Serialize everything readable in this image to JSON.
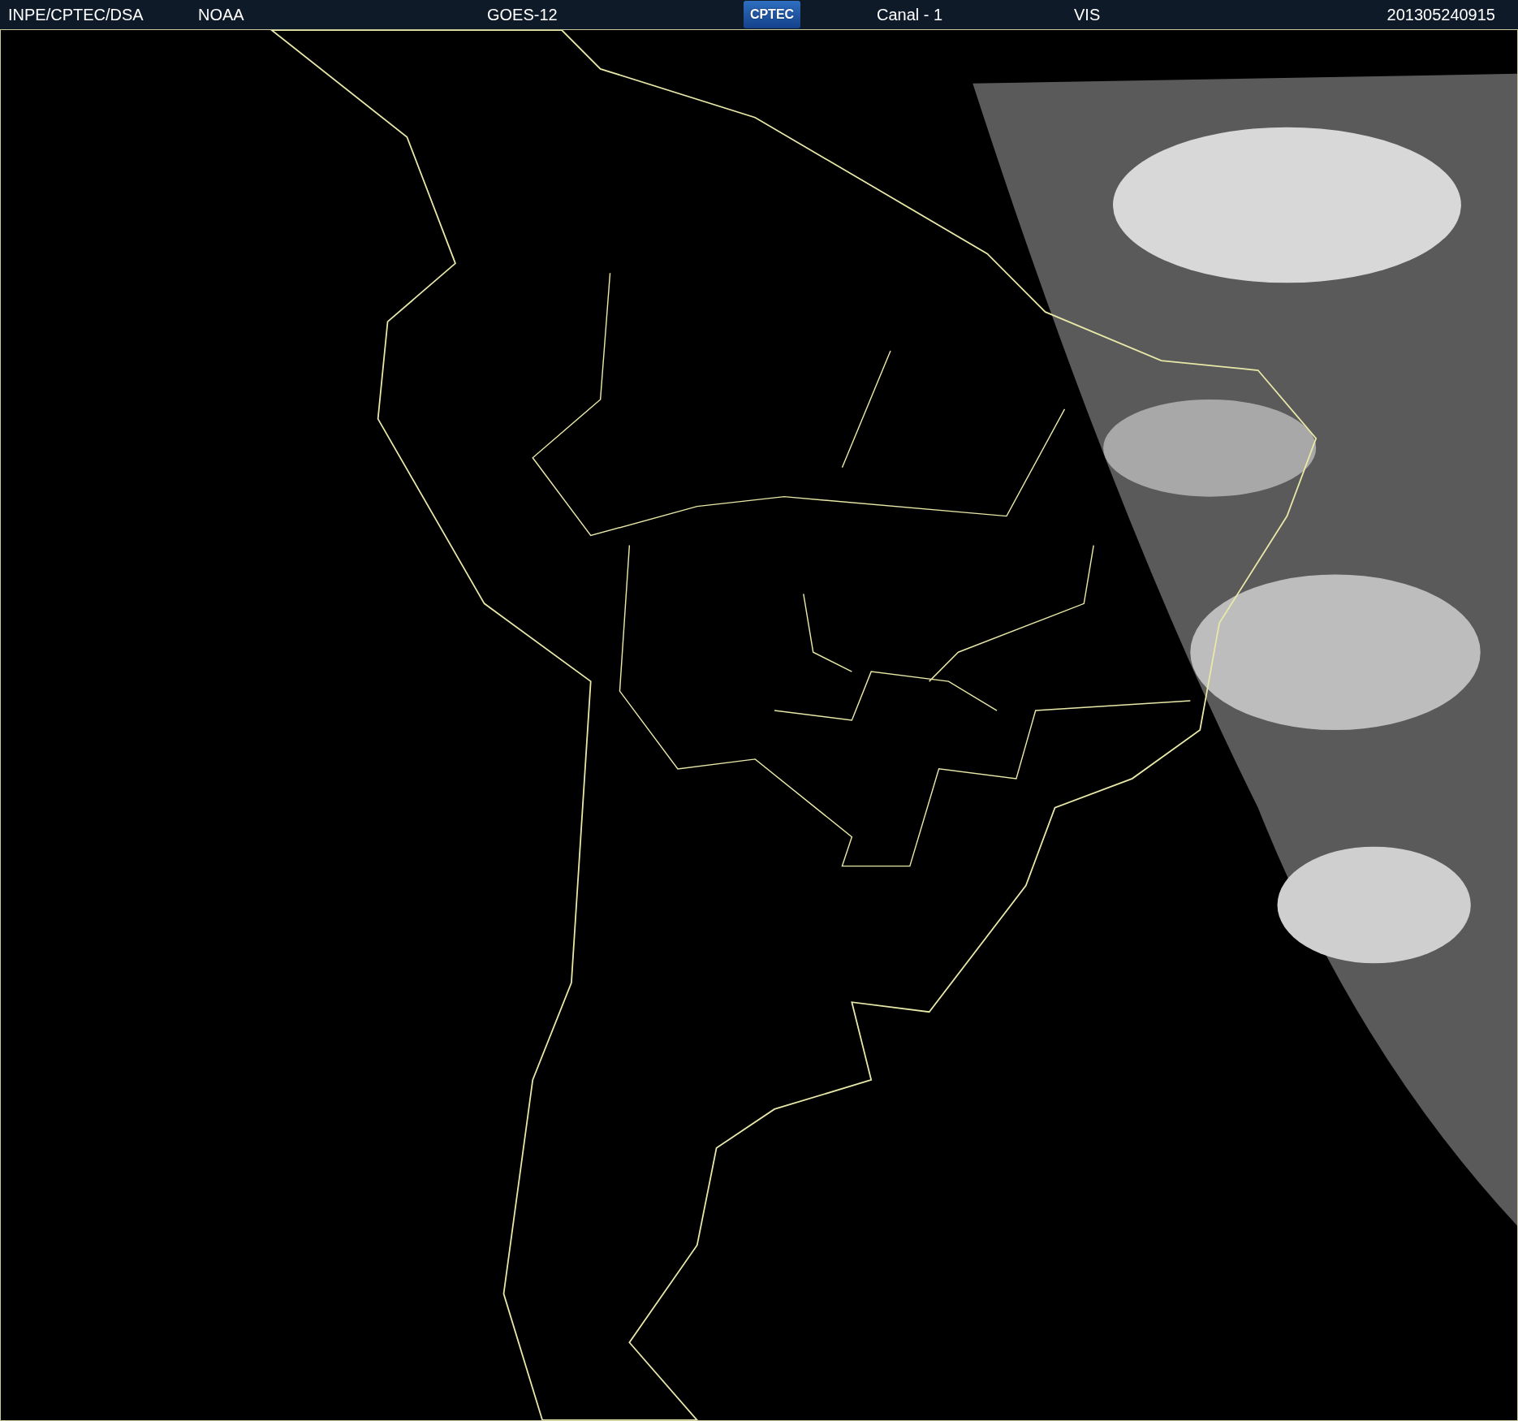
{
  "header": {
    "items": [
      {
        "kind": "text",
        "text": "INPE/CPTEC/DSA"
      },
      {
        "kind": "text",
        "text": "NOAA"
      },
      {
        "kind": "text",
        "text": "GOES-12"
      },
      {
        "kind": "logo",
        "text": "CPTEC"
      },
      {
        "kind": "text",
        "text": "Canal - 1"
      },
      {
        "kind": "text",
        "text": "VIS"
      },
      {
        "kind": "text",
        "text": "201305240915"
      }
    ]
  }
}
